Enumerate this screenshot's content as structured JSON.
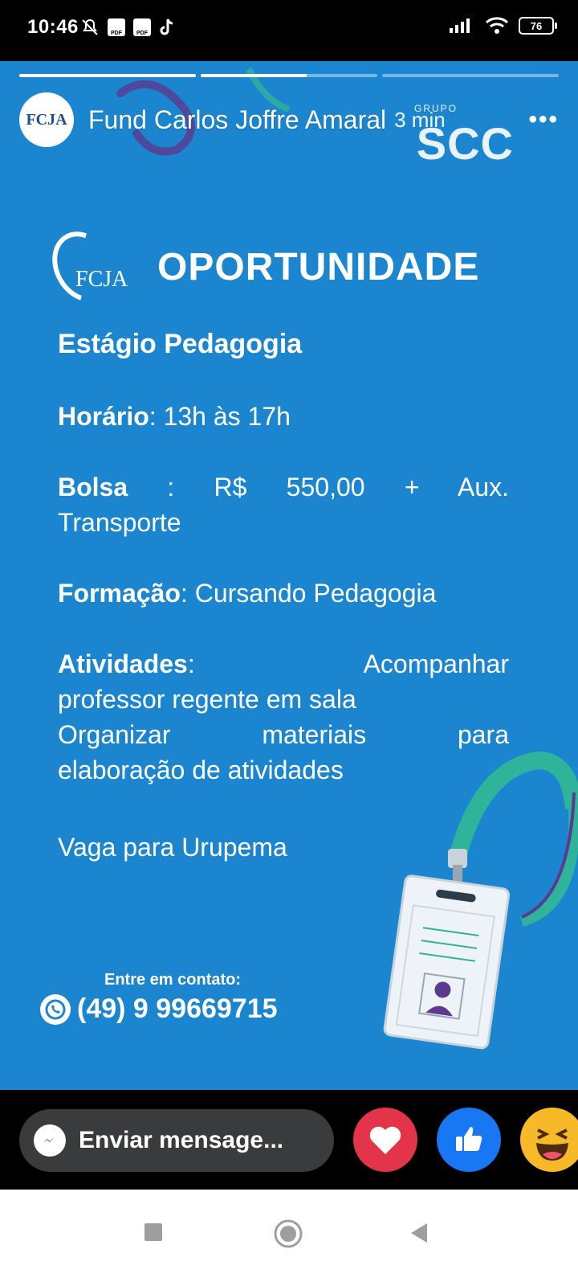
{
  "status_bar": {
    "time": "10:46",
    "battery": "76",
    "icons_left": [
      "mute-icon",
      "pdf-icon",
      "pdf-icon",
      "tiktok-icon"
    ],
    "icons_right": [
      "signal-icon",
      "wifi-icon",
      "battery-icon"
    ]
  },
  "story": {
    "progress": [
      1.0,
      0.6,
      0.0
    ],
    "author": "Fund Carlos Joffre Amaral",
    "time_ago": "3 min",
    "avatar_text": "FCJA",
    "more_label": "•••"
  },
  "flyer": {
    "brand_top": "SCC",
    "brand_top_small": "GRUPO",
    "logo_text": "FCJA",
    "heading": "OPORTUNIDADE",
    "title": "Estágio Pedagogia",
    "horario_label": "Horário",
    "horario_value": ": 13h às 17h",
    "bolsa_label": "Bolsa",
    "bolsa_value": " : R$ 550,00 + Aux. Transporte",
    "formacao_label": "Formação",
    "formacao_value": ": Cursando  Pedagogia",
    "atividades_label": "Atividades",
    "atividades_line1_tail": ": Acompanhar",
    "atividades_line2": "professor regente em sala",
    "atividades_line3": "Organizar materiais para",
    "atividades_line4": "elaboração de atividades",
    "vaga": "Vaga para Urupema",
    "contact_label": "Entre em contato:",
    "phone": "(49) 9 99669715",
    "accent_color": "#1b86cf"
  },
  "bottom": {
    "message_placeholder": "Enviar mensage...",
    "reactions": [
      "heart-icon",
      "like-icon",
      "haha-icon"
    ]
  },
  "navbar": {
    "buttons": [
      "recents-button",
      "home-button",
      "back-button"
    ]
  }
}
